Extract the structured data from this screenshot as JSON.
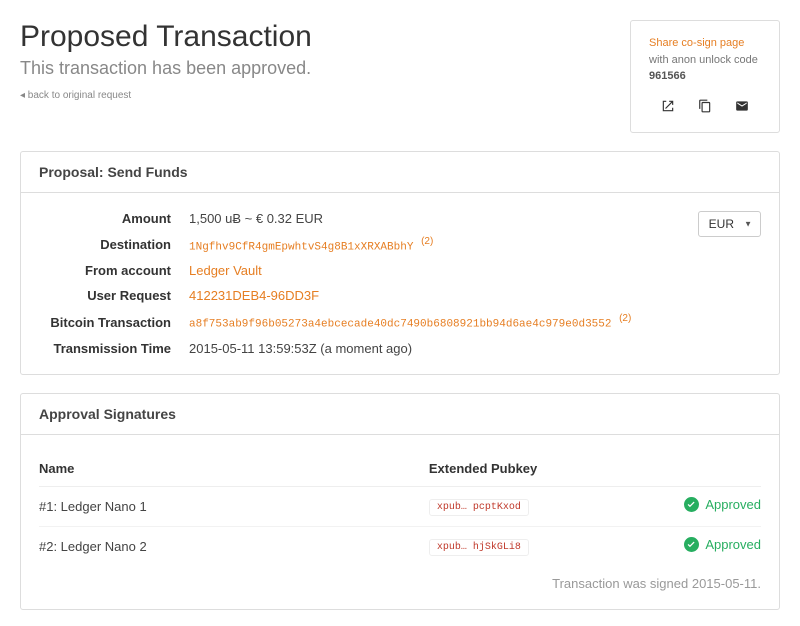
{
  "header": {
    "title": "Proposed Transaction",
    "subtitle": "This transaction has been approved.",
    "back_label": "◂ back to original request"
  },
  "share": {
    "link_text": "Share co-sign page",
    "middle_text": " with anon unlock code ",
    "code": "961566"
  },
  "proposal": {
    "panel_title": "Proposal: Send Funds",
    "labels": {
      "amount": "Amount",
      "destination": "Destination",
      "from_account": "From account",
      "user_request": "User Request",
      "bitcoin_tx": "Bitcoin Transaction",
      "transmission_time": "Transmission Time"
    },
    "amount": "1,500 uɃ ~ € 0.32 EUR",
    "destination": "1Ngfhv9CfR4gmEpwhtvS4g8B1xXRXABbhY",
    "dest_badge": "(2)",
    "from_account": "Ledger Vault",
    "user_request": "412231DEB4-96DD3F",
    "bitcoin_tx": "a8f753ab9f96b05273a4ebcecade40dc7490b6808921bb94d6ae4c979e0d3552",
    "tx_badge": "(2)",
    "transmission_time": "2015-05-11 13:59:53Z (a moment ago)",
    "currency_selector": "EUR"
  },
  "approvals": {
    "panel_title": "Approval Signatures",
    "columns": {
      "name": "Name",
      "pubkey": "Extended Pubkey",
      "status": ""
    },
    "rows": [
      {
        "name": "#1: Ledger Nano 1",
        "pubkey": "xpub… pcptKxod",
        "status": "Approved"
      },
      {
        "name": "#2: Ledger Nano 2",
        "pubkey": "xpub… hjSkGLi8",
        "status": "Approved"
      }
    ],
    "signed_note": "Transaction was signed 2015-05-11."
  }
}
